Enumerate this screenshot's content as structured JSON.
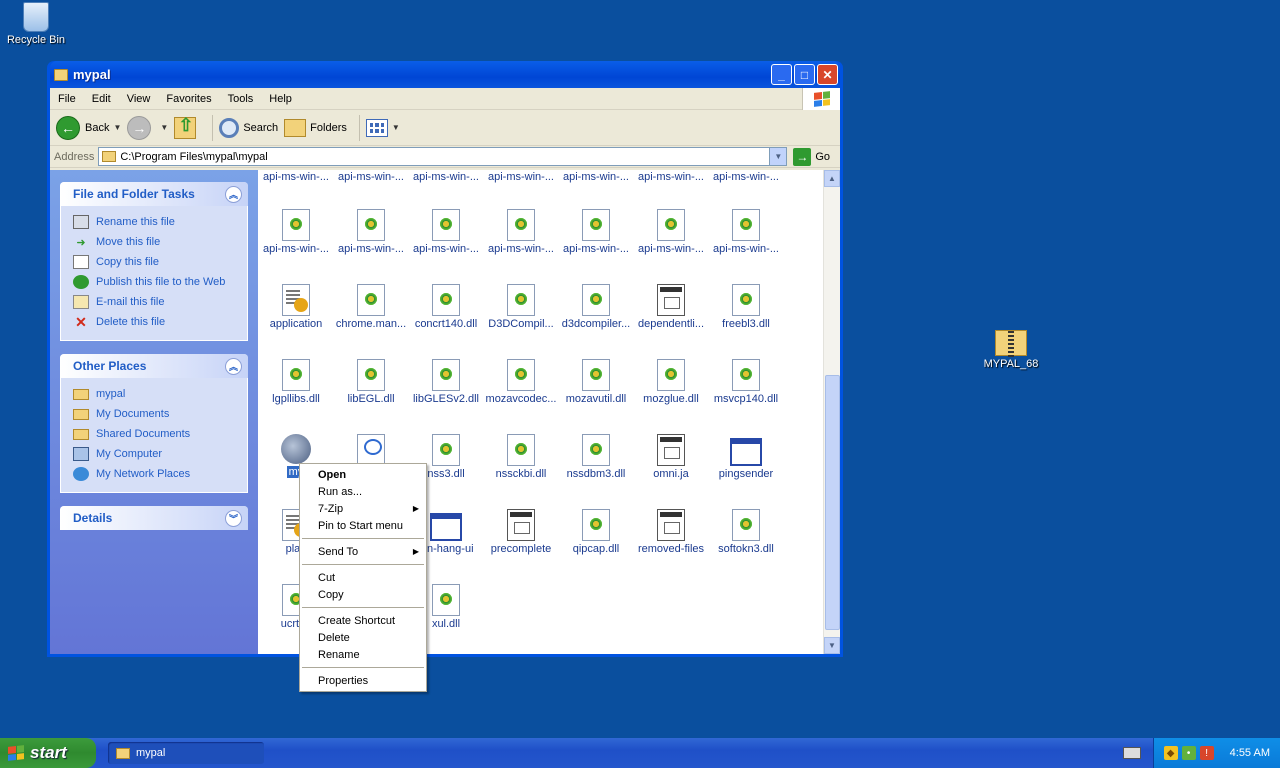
{
  "desktop": {
    "recycle_bin": "Recycle Bin",
    "zip_file": "MYPAL_68"
  },
  "window": {
    "title": "mypal",
    "menu": [
      "File",
      "Edit",
      "View",
      "Favorites",
      "Tools",
      "Help"
    ],
    "toolbar": {
      "back": "Back",
      "search": "Search",
      "folders": "Folders"
    },
    "address": {
      "label": "Address",
      "value": "C:\\Program Files\\mypal\\mypal",
      "go": "Go"
    }
  },
  "left_pane": {
    "file_tasks": {
      "title": "File and Folder Tasks",
      "items": [
        {
          "label": "Rename this file",
          "icon": "rename-icon"
        },
        {
          "label": "Move this file",
          "icon": "move-icon"
        },
        {
          "label": "Copy this file",
          "icon": "copy-icon"
        },
        {
          "label": "Publish this file to the Web",
          "icon": "globe-icon"
        },
        {
          "label": "E-mail this file",
          "icon": "email-icon"
        },
        {
          "label": "Delete this file",
          "icon": "delete-icon"
        }
      ]
    },
    "other_places": {
      "title": "Other Places",
      "items": [
        {
          "label": "mypal",
          "icon": "folder-icon"
        },
        {
          "label": "My Documents",
          "icon": "folder-icon"
        },
        {
          "label": "Shared Documents",
          "icon": "folder-icon"
        },
        {
          "label": "My Computer",
          "icon": "computer-icon"
        },
        {
          "label": "My Network Places",
          "icon": "network-icon"
        }
      ]
    },
    "details": {
      "title": "Details"
    }
  },
  "files": {
    "row0": [
      "api-ms-win-...",
      "api-ms-win-...",
      "api-ms-win-...",
      "api-ms-win-...",
      "api-ms-win-...",
      "api-ms-win-...",
      "api-ms-win-..."
    ],
    "row1": [
      "api-ms-win-...",
      "api-ms-win-...",
      "api-ms-win-...",
      "api-ms-win-...",
      "api-ms-win-...",
      "api-ms-win-...",
      "api-ms-win-..."
    ],
    "row2": [
      "application",
      "chrome.man...",
      "concrt140.dll",
      "D3DCompil...",
      "d3dcompiler...",
      "dependentli...",
      "freebl3.dll"
    ],
    "row3": [
      "lgpllibs.dll",
      "libEGL.dll",
      "libGLESv2.dll",
      "mozavcodec...",
      "mozavutil.dll",
      "mozglue.dll",
      "msvcp140.dll"
    ],
    "row4": [
      "my",
      "",
      "nss3.dll",
      "nssckbi.dll",
      "nssdbm3.dll",
      "omni.ja",
      "pingsender"
    ],
    "row5": [
      "platf",
      "",
      "gin-hang-ui",
      "precomplete",
      "qipcap.dll",
      "removed-files",
      "softokn3.dll"
    ],
    "row6": [
      "ucrtba",
      "",
      "xul.dll"
    ]
  },
  "context_menu": {
    "open": "Open",
    "run_as": "Run as...",
    "zip": "7-Zip",
    "pin": "Pin to Start menu",
    "send_to": "Send To",
    "cut": "Cut",
    "copy": "Copy",
    "create_shortcut": "Create Shortcut",
    "delete": "Delete",
    "rename": "Rename",
    "properties": "Properties"
  },
  "taskbar": {
    "start": "start",
    "task": "mypal",
    "clock": "4:55 AM"
  },
  "colors": {
    "desktop": "#0a4f9e",
    "link": "#215dc6",
    "selection": "#316ac5"
  }
}
